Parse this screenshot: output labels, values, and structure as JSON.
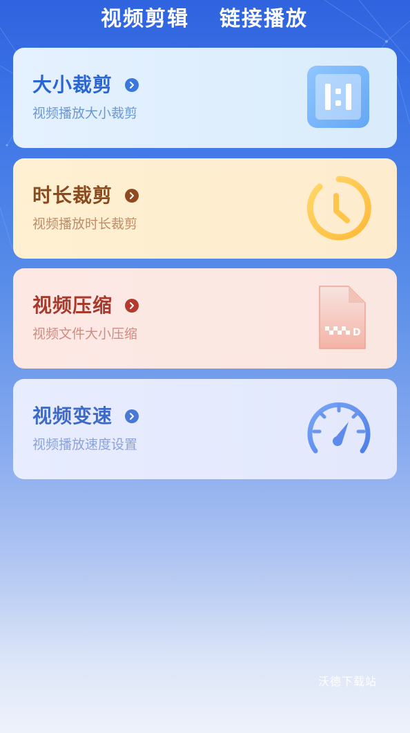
{
  "header": {
    "tabs": [
      {
        "label": "视频剪辑",
        "active": true
      },
      {
        "label": "链接播放",
        "active": false
      }
    ]
  },
  "cards": [
    {
      "title": "大小裁剪",
      "subtitle": "视频播放大小裁剪",
      "icon": "aspect-ratio-icon",
      "accent": "#2a66d2"
    },
    {
      "title": "时长裁剪",
      "subtitle": "视频播放时长裁剪",
      "icon": "clock-icon",
      "accent": "#8a4a20"
    },
    {
      "title": "视频压缩",
      "subtitle": "视频文件大小压缩",
      "icon": "compressed-file-icon",
      "accent": "#a63a2c"
    },
    {
      "title": "视频变速",
      "subtitle": "视频播放速度设置",
      "icon": "speedometer-icon",
      "accent": "#3e6ac7"
    }
  ],
  "watermark": "沃德下载站",
  "colors": {
    "background_top": "#2f63df",
    "background_bottom": "#eef2fb"
  }
}
